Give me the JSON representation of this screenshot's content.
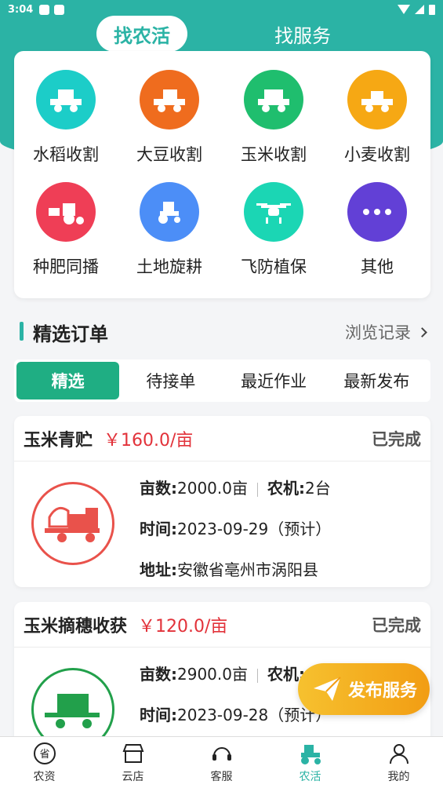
{
  "status_bar": {
    "time": "3:04"
  },
  "top_tabs": [
    {
      "label": "找农活",
      "active": true
    },
    {
      "label": "找服务",
      "active": false
    }
  ],
  "categories": [
    {
      "label": "水稻收割",
      "color": "#1ccdc8",
      "icon": "rice-harvester-icon"
    },
    {
      "label": "大豆收割",
      "color": "#ef6c1e",
      "icon": "soybean-harvester-icon"
    },
    {
      "label": "玉米收割",
      "color": "#1fbe6e",
      "icon": "corn-harvester-icon"
    },
    {
      "label": "小麦收割",
      "color": "#f6a814",
      "icon": "wheat-harvester-icon"
    },
    {
      "label": "种肥同播",
      "color": "#ef3e56",
      "icon": "seed-fertilizer-tractor-icon"
    },
    {
      "label": "土地旋耕",
      "color": "#4c8ef7",
      "icon": "tillage-tractor-icon"
    },
    {
      "label": "飞防植保",
      "color": "#1bd6b4",
      "icon": "drone-icon"
    },
    {
      "label": "其他",
      "color": "#6240d6",
      "icon": "more-dots-icon"
    }
  ],
  "section": {
    "title": "精选订单",
    "link": "浏览记录"
  },
  "filters": [
    {
      "label": "精选",
      "active": true
    },
    {
      "label": "待接单",
      "active": false
    },
    {
      "label": "最近作业",
      "active": false
    },
    {
      "label": "最新发布",
      "active": false
    }
  ],
  "orders": [
    {
      "name": "玉米青贮",
      "price": "￥160.0/亩",
      "status": "已完成",
      "area_label": "亩数:",
      "area": "2000.0亩",
      "machine_label": "农机:",
      "machines": "2台",
      "time_label": "时间:",
      "time": "2023-09-29（预计）",
      "address_label": "地址:",
      "address": "安徽省亳州市涡阳县",
      "icon_color": "#e9524b"
    },
    {
      "name": "玉米摘穗收获",
      "price": "￥120.0/亩",
      "status": "已完成",
      "area_label": "亩数:",
      "area": "2900.0亩",
      "machine_label": "农机:",
      "machines": "",
      "time_label": "时间:",
      "time": "2023-09-28（预计）",
      "icon_color": "#22a04b"
    }
  ],
  "fab": {
    "label": "发布服务"
  },
  "bottom_nav": [
    {
      "label": "农资",
      "active": false
    },
    {
      "label": "云店",
      "active": false
    },
    {
      "label": "客服",
      "active": false
    },
    {
      "label": "农活",
      "active": true
    },
    {
      "label": "我的",
      "active": false
    }
  ],
  "colors": {
    "primary": "#2bb3a5",
    "price": "#e2323a",
    "filter_active": "#1fae83"
  }
}
